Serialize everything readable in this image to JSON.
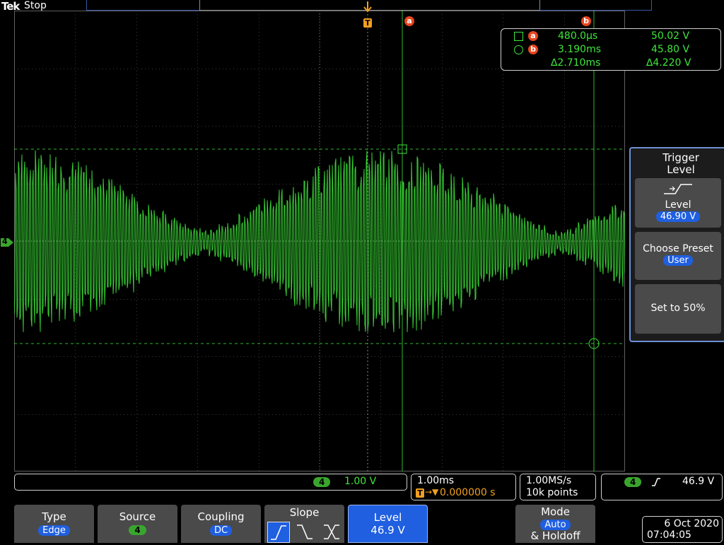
{
  "header": {
    "brand": "Tek",
    "acq_state": "Stop"
  },
  "colors": {
    "trace": "#3ee63a",
    "cursor_marker": "#e8451e",
    "trigger_marker": "#f0a021",
    "active": "#1f5fe0",
    "menu_bg": "#4a4a4a"
  },
  "cursor_readout": {
    "a": {
      "marker": "a",
      "time": "480.0µs",
      "volts": "50.02 V"
    },
    "b": {
      "marker": "b",
      "time": "3.190ms",
      "volts": "45.80 V"
    },
    "delta": {
      "time": "∆2.710ms",
      "volts": "∆4.220 V"
    }
  },
  "markers": {
    "trigger": "T",
    "cursor_a": "a",
    "cursor_b": "b",
    "channel": "4"
  },
  "side_menu": {
    "title": "Trigger Level",
    "level": {
      "label": "Level",
      "value": "46.90 V"
    },
    "preset": {
      "label": "Choose Preset",
      "value": "User"
    },
    "half": {
      "label": "Set to 50%"
    }
  },
  "status": {
    "channel": {
      "badge": "4",
      "scale": "1.00 V"
    },
    "timebase": {
      "scale": "1.00ms",
      "position": "0.000000 s"
    },
    "acquisition": {
      "rate": "1.00MS/s",
      "length": "10k points"
    },
    "trigger": {
      "source": "4",
      "level": "46.9 V"
    }
  },
  "bottom_menu": {
    "type": {
      "label": "Type",
      "value": "Edge"
    },
    "source": {
      "label": "Source",
      "value": "4"
    },
    "coupling": {
      "label": "Coupling",
      "value": "DC"
    },
    "slope": {
      "label": "Slope"
    },
    "level": {
      "label": "Level",
      "value": "46.9 V"
    },
    "mode": {
      "line1": "Mode",
      "value": "Auto",
      "line3": "& Holdoff"
    }
  },
  "datetime": {
    "date": "6 Oct  2020",
    "time": "07:04:05"
  }
}
